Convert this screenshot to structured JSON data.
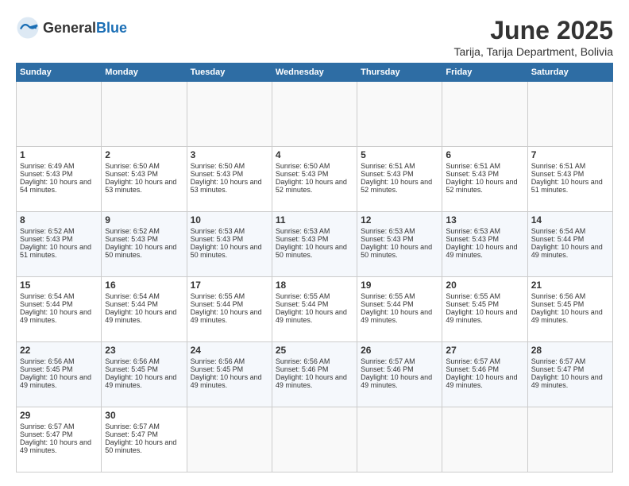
{
  "header": {
    "logo_general": "General",
    "logo_blue": "Blue",
    "month": "June 2025",
    "location": "Tarija, Tarija Department, Bolivia"
  },
  "calendar": {
    "days_of_week": [
      "Sunday",
      "Monday",
      "Tuesday",
      "Wednesday",
      "Thursday",
      "Friday",
      "Saturday"
    ],
    "weeks": [
      [
        {
          "day": "",
          "info": ""
        },
        {
          "day": "",
          "info": ""
        },
        {
          "day": "",
          "info": ""
        },
        {
          "day": "",
          "info": ""
        },
        {
          "day": "",
          "info": ""
        },
        {
          "day": "",
          "info": ""
        },
        {
          "day": "",
          "info": ""
        }
      ],
      [
        {
          "day": "1",
          "sunrise": "6:49 AM",
          "sunset": "5:43 PM",
          "daylight": "10 hours and 54 minutes."
        },
        {
          "day": "2",
          "sunrise": "6:50 AM",
          "sunset": "5:43 PM",
          "daylight": "10 hours and 53 minutes."
        },
        {
          "day": "3",
          "sunrise": "6:50 AM",
          "sunset": "5:43 PM",
          "daylight": "10 hours and 53 minutes."
        },
        {
          "day": "4",
          "sunrise": "6:50 AM",
          "sunset": "5:43 PM",
          "daylight": "10 hours and 52 minutes."
        },
        {
          "day": "5",
          "sunrise": "6:51 AM",
          "sunset": "5:43 PM",
          "daylight": "10 hours and 52 minutes."
        },
        {
          "day": "6",
          "sunrise": "6:51 AM",
          "sunset": "5:43 PM",
          "daylight": "10 hours and 52 minutes."
        },
        {
          "day": "7",
          "sunrise": "6:51 AM",
          "sunset": "5:43 PM",
          "daylight": "10 hours and 51 minutes."
        }
      ],
      [
        {
          "day": "8",
          "sunrise": "6:52 AM",
          "sunset": "5:43 PM",
          "daylight": "10 hours and 51 minutes."
        },
        {
          "day": "9",
          "sunrise": "6:52 AM",
          "sunset": "5:43 PM",
          "daylight": "10 hours and 50 minutes."
        },
        {
          "day": "10",
          "sunrise": "6:53 AM",
          "sunset": "5:43 PM",
          "daylight": "10 hours and 50 minutes."
        },
        {
          "day": "11",
          "sunrise": "6:53 AM",
          "sunset": "5:43 PM",
          "daylight": "10 hours and 50 minutes."
        },
        {
          "day": "12",
          "sunrise": "6:53 AM",
          "sunset": "5:43 PM",
          "daylight": "10 hours and 50 minutes."
        },
        {
          "day": "13",
          "sunrise": "6:53 AM",
          "sunset": "5:43 PM",
          "daylight": "10 hours and 49 minutes."
        },
        {
          "day": "14",
          "sunrise": "6:54 AM",
          "sunset": "5:44 PM",
          "daylight": "10 hours and 49 minutes."
        }
      ],
      [
        {
          "day": "15",
          "sunrise": "6:54 AM",
          "sunset": "5:44 PM",
          "daylight": "10 hours and 49 minutes."
        },
        {
          "day": "16",
          "sunrise": "6:54 AM",
          "sunset": "5:44 PM",
          "daylight": "10 hours and 49 minutes."
        },
        {
          "day": "17",
          "sunrise": "6:55 AM",
          "sunset": "5:44 PM",
          "daylight": "10 hours and 49 minutes."
        },
        {
          "day": "18",
          "sunrise": "6:55 AM",
          "sunset": "5:44 PM",
          "daylight": "10 hours and 49 minutes."
        },
        {
          "day": "19",
          "sunrise": "6:55 AM",
          "sunset": "5:44 PM",
          "daylight": "10 hours and 49 minutes."
        },
        {
          "day": "20",
          "sunrise": "6:55 AM",
          "sunset": "5:45 PM",
          "daylight": "10 hours and 49 minutes."
        },
        {
          "day": "21",
          "sunrise": "6:56 AM",
          "sunset": "5:45 PM",
          "daylight": "10 hours and 49 minutes."
        }
      ],
      [
        {
          "day": "22",
          "sunrise": "6:56 AM",
          "sunset": "5:45 PM",
          "daylight": "10 hours and 49 minutes."
        },
        {
          "day": "23",
          "sunrise": "6:56 AM",
          "sunset": "5:45 PM",
          "daylight": "10 hours and 49 minutes."
        },
        {
          "day": "24",
          "sunrise": "6:56 AM",
          "sunset": "5:45 PM",
          "daylight": "10 hours and 49 minutes."
        },
        {
          "day": "25",
          "sunrise": "6:56 AM",
          "sunset": "5:46 PM",
          "daylight": "10 hours and 49 minutes."
        },
        {
          "day": "26",
          "sunrise": "6:57 AM",
          "sunset": "5:46 PM",
          "daylight": "10 hours and 49 minutes."
        },
        {
          "day": "27",
          "sunrise": "6:57 AM",
          "sunset": "5:46 PM",
          "daylight": "10 hours and 49 minutes."
        },
        {
          "day": "28",
          "sunrise": "6:57 AM",
          "sunset": "5:47 PM",
          "daylight": "10 hours and 49 minutes."
        }
      ],
      [
        {
          "day": "29",
          "sunrise": "6:57 AM",
          "sunset": "5:47 PM",
          "daylight": "10 hours and 49 minutes."
        },
        {
          "day": "30",
          "sunrise": "6:57 AM",
          "sunset": "5:47 PM",
          "daylight": "10 hours and 50 minutes."
        },
        {
          "day": "",
          "info": ""
        },
        {
          "day": "",
          "info": ""
        },
        {
          "day": "",
          "info": ""
        },
        {
          "day": "",
          "info": ""
        },
        {
          "day": "",
          "info": ""
        }
      ]
    ]
  }
}
